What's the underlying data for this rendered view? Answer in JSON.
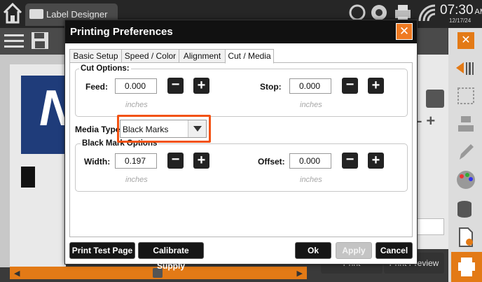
{
  "topbar": {
    "app_tab_label": "Label Designer",
    "time": "07:30",
    "ampm": "AM",
    "date": "12/17/24"
  },
  "dialog": {
    "title": "Printing Preferences",
    "tabs": [
      {
        "label": "Basic Setup",
        "active": false
      },
      {
        "label": "Speed / Color",
        "active": false
      },
      {
        "label": "Alignment",
        "active": false
      },
      {
        "label": "Cut / Media",
        "active": true
      }
    ],
    "cut_options": {
      "title": "Cut Options:",
      "feed_label": "Feed:",
      "feed_value": "0.000",
      "stop_label": "Stop:",
      "stop_value": "0.000",
      "unit": "inches"
    },
    "media_type": {
      "label": "Media Type:",
      "selected": "Black Marks"
    },
    "black_mark_options": {
      "title": "Black Mark Options",
      "width_label": "Width:",
      "width_value": "0.197",
      "offset_label": "Offset:",
      "offset_value": "0.000",
      "unit": "inches"
    },
    "buttons": {
      "print_test_page": "Print Test Page",
      "calibrate_supply": "Calibrate Supply",
      "ok": "Ok",
      "apply": "Apply",
      "cancel": "Cancel"
    },
    "highlight_color": "#f25212"
  },
  "background": {
    "label_letter": "N",
    "print_button": "Print",
    "print_preview_button": "Print Preview"
  },
  "colors": {
    "accent": "#e37a16",
    "dialog_title_bg": "#111111",
    "label_blue": "#1f3c7a"
  }
}
